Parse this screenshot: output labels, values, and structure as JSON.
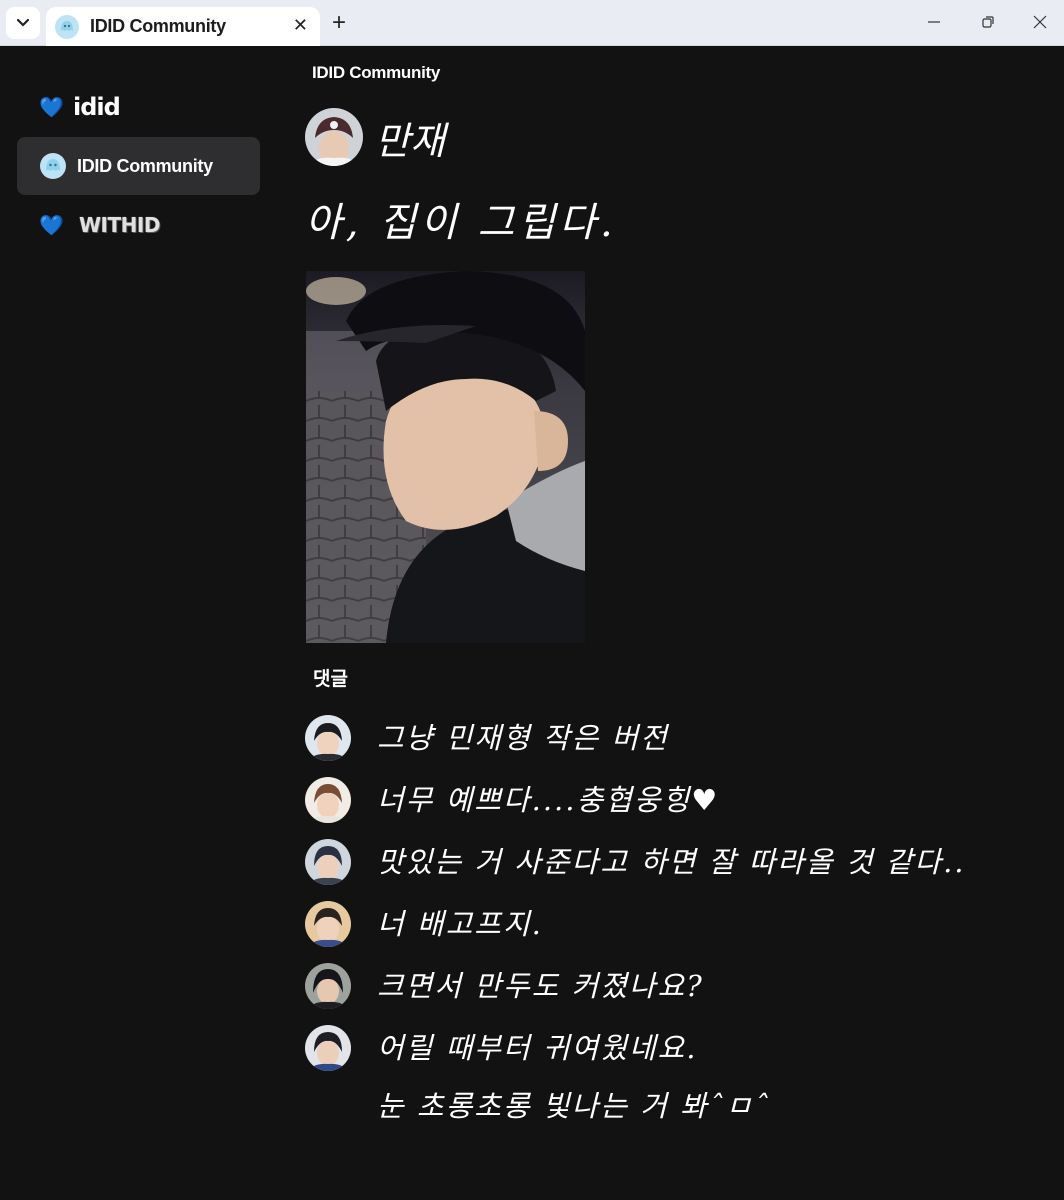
{
  "browser": {
    "tab_title": "IDID Community",
    "close_glyph": "✕",
    "new_tab_glyph": "+"
  },
  "sidebar": {
    "items": [
      {
        "logo_text": "idid",
        "icon": "heart-icon"
      },
      {
        "label": "IDID Community",
        "icon": "ghost-icon"
      },
      {
        "logo_text": "WITHID",
        "icon": "heart-icon"
      }
    ]
  },
  "main": {
    "page_title": "IDID Community",
    "author": "만재",
    "post_text": "아, 집이 그립다.",
    "comments_label": "댓글",
    "comments": [
      {
        "text": "그냥 민재형 작은 버전"
      },
      {
        "text": "너무 예쁘다....충협웅힝♥"
      },
      {
        "text": "맛있는 거 사준다고 하면 잘 따라올 것 같다.."
      },
      {
        "text": "너 배고프지."
      },
      {
        "text": "크면서 만두도 커졌나요?"
      },
      {
        "text": "어릴 때부터 귀여웠네요.",
        "text2": "눈 초롱초롱 빛나는 거 봐ˆㅁˆ"
      }
    ]
  },
  "colors": {
    "background": "#121212",
    "accent_heart": "#3aa0f0",
    "active_item": "#2e2e30"
  }
}
